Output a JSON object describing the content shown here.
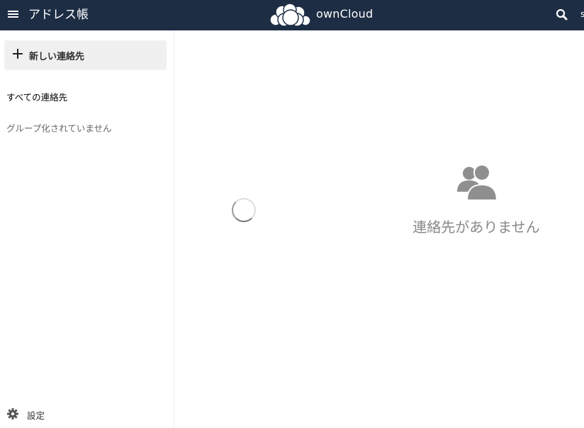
{
  "header": {
    "app_title": "アドレス帳",
    "brand_text": "ownCloud",
    "user_initial": "s",
    "colors": {
      "background": "#1d2d44",
      "foreground": "#ffffff"
    }
  },
  "sidebar": {
    "new_contact_label": "新しい連絡先",
    "groups": [
      {
        "label": "すべての連絡先"
      },
      {
        "label": "グループ化されていません"
      }
    ],
    "settings_label": "設定"
  },
  "main": {
    "empty_message": "連絡先がありません",
    "empty_icon": "contacts-group-icon",
    "loading_icon": "loading-spinner-icon"
  },
  "icons": {
    "menu": "hamburger-menu-icon",
    "search": "search-icon",
    "settings": "gear-icon",
    "add": "plus-icon",
    "brand": "owncloud-cloud-logo"
  }
}
